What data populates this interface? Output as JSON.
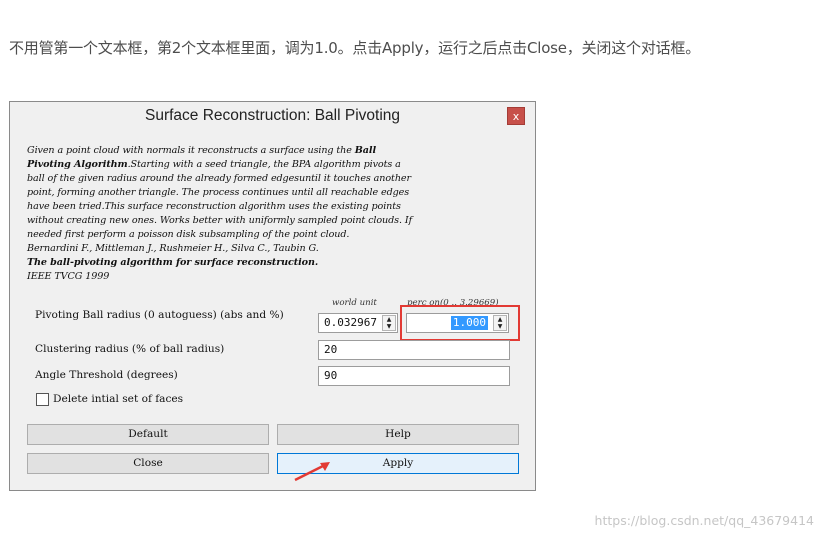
{
  "instruction": "不用管第一个文本框，第2个文本框里面，调为1.0。点击Apply，运行之后点击Close，关闭这个对话框。",
  "dialog": {
    "title": "Surface Reconstruction: Ball Pivoting",
    "close_glyph": "x",
    "description": {
      "line1_a": "Given a point cloud with normals it reconstructs a surface using the ",
      "line1_b": "Ball",
      "line2_a": "Pivoting Algorithm",
      "line2_b": ".Starting with a seed triangle,  the BPA algorithm pivots a",
      "line3": "ball of the given radius around the already formed edgesuntil it touches another",
      "line4": "point, forming another triangle. The process continues until all reachable edges",
      "line5": "have been tried.This surface reconstruction algorithm uses the existing points",
      "line6": "without creating new ones. Works better with uniformly sampled point clouds.  If",
      "line7": "needed first perform a poisson disk subsampling of the point cloud.",
      "line8": "Bernardini F., Mittleman J., Rushmeier H., Silva C., Taubin G.",
      "line9": "The ball-pivoting algorithm for surface reconstruction.",
      "line10": "IEEE TVCG 1999"
    },
    "pivot_radius": {
      "label": "Pivoting Ball radius (0 autoguess) (abs and %)",
      "world_unit_label": "world unit",
      "perc_label": "perc on(0 .. 3.29669)",
      "world_value": "0.032967",
      "perc_value": "1.000"
    },
    "clustering": {
      "label": "Clustering radius (% of ball radius)",
      "value": "20"
    },
    "angle": {
      "label": "Angle Threshold (degrees)",
      "value": "90"
    },
    "delete_faces": {
      "label": "Delete intial set of faces",
      "checked": false
    },
    "buttons": {
      "default": "Default",
      "help": "Help",
      "close": "Close",
      "apply": "Apply"
    }
  },
  "watermark": "https://blog.csdn.net/qq_43679414",
  "colors": {
    "highlight": "#e23a34",
    "selection": "#3399ff",
    "close_button": "#c7504a"
  },
  "icons": {
    "up": "spin-up-icon",
    "down": "spin-down-icon",
    "annotation": "red-arrow-icon"
  }
}
